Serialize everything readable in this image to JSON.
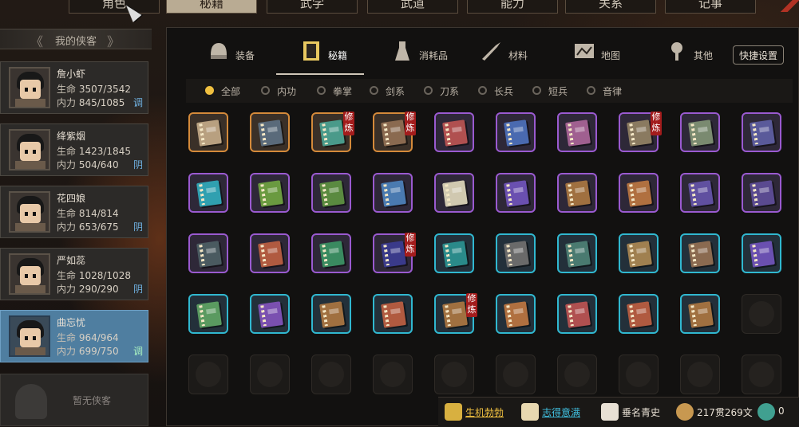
{
  "top_tabs": [
    {
      "label": "角色",
      "active": false
    },
    {
      "label": "秘籍",
      "active": true
    },
    {
      "label": "武学",
      "active": false
    },
    {
      "label": "武道",
      "active": false
    },
    {
      "label": "能力",
      "active": false
    },
    {
      "label": "关系",
      "active": false
    },
    {
      "label": "记事",
      "active": false
    }
  ],
  "sidebar": {
    "header": "我的侠客",
    "characters": [
      {
        "name": "詹小虾",
        "hp_label": "生命",
        "hp": "3507/3542",
        "mp_label": "内力",
        "mp": "845/1085",
        "tag": "调",
        "active": false
      },
      {
        "name": "绛紫烟",
        "hp_label": "生命",
        "hp": "1423/1845",
        "mp_label": "内力",
        "mp": "504/640",
        "tag": "阴",
        "active": false
      },
      {
        "name": "花四娘",
        "hp_label": "生命",
        "hp": "814/814",
        "mp_label": "内力",
        "mp": "653/675",
        "tag": "阴",
        "active": false
      },
      {
        "name": "严如蕊",
        "hp_label": "生命",
        "hp": "1028/1028",
        "mp_label": "内力",
        "mp": "290/290",
        "tag": "阴",
        "active": false
      },
      {
        "name": "曲忘忧",
        "hp_label": "生命",
        "hp": "964/964",
        "mp_label": "内力",
        "mp": "699/750",
        "tag": "调",
        "active": true
      }
    ],
    "empty_slot": "暂无侠客"
  },
  "categories": [
    {
      "label": "装备",
      "icon": "helmet-icon",
      "active": false
    },
    {
      "label": "秘籍",
      "icon": "scroll-icon",
      "active": true
    },
    {
      "label": "消耗品",
      "icon": "potion-icon",
      "active": false
    },
    {
      "label": "材料",
      "icon": "herb-icon",
      "active": false
    },
    {
      "label": "地图",
      "icon": "map-icon",
      "active": false
    },
    {
      "label": "其他",
      "icon": "misc-icon",
      "active": false
    }
  ],
  "quick_settings": "快捷设置",
  "filters": [
    {
      "label": "全部",
      "active": true
    },
    {
      "label": "内功",
      "active": false
    },
    {
      "label": "拳掌",
      "active": false
    },
    {
      "label": "剑系",
      "active": false
    },
    {
      "label": "刀系",
      "active": false
    },
    {
      "label": "长兵",
      "active": false
    },
    {
      "label": "短兵",
      "active": false
    },
    {
      "label": "音律",
      "active": false
    }
  ],
  "practice_tag": "修炼",
  "items": [
    {
      "rarity": "orange",
      "color": "#b8a080",
      "tag": false
    },
    {
      "rarity": "orange",
      "color": "#5a6a7a",
      "tag": false
    },
    {
      "rarity": "orange",
      "color": "#4a9a8a",
      "tag": true
    },
    {
      "rarity": "orange",
      "color": "#8a6a50",
      "tag": true
    },
    {
      "rarity": "purple",
      "color": "#b05050",
      "tag": false
    },
    {
      "rarity": "purple",
      "color": "#4a6ab0",
      "tag": false
    },
    {
      "rarity": "purple",
      "color": "#a06090",
      "tag": false
    },
    {
      "rarity": "purple",
      "color": "#8a7a60",
      "tag": true
    },
    {
      "rarity": "purple",
      "color": "#7a8a70",
      "tag": false
    },
    {
      "rarity": "purple",
      "color": "#5a5a9a",
      "tag": false
    },
    {
      "rarity": "purple",
      "color": "#30a0b0",
      "tag": false
    },
    {
      "rarity": "purple",
      "color": "#6a9a40",
      "tag": false
    },
    {
      "rarity": "purple",
      "color": "#5a8a40",
      "tag": false
    },
    {
      "rarity": "purple",
      "color": "#4a7ab0",
      "tag": false
    },
    {
      "rarity": "purple",
      "color": "#d0c8b0",
      "tag": false
    },
    {
      "rarity": "purple",
      "color": "#6a50b0",
      "tag": false
    },
    {
      "rarity": "purple",
      "color": "#a07040",
      "tag": false
    },
    {
      "rarity": "purple",
      "color": "#b07040",
      "tag": false
    },
    {
      "rarity": "purple",
      "color": "#6050a0",
      "tag": false
    },
    {
      "rarity": "purple",
      "color": "#5a4a90",
      "tag": false
    },
    {
      "rarity": "purple",
      "color": "#4a5a60",
      "tag": false
    },
    {
      "rarity": "purple",
      "color": "#b05a40",
      "tag": false
    },
    {
      "rarity": "purple",
      "color": "#3a8a60",
      "tag": false
    },
    {
      "rarity": "purple",
      "color": "#3a3a8a",
      "tag": true
    },
    {
      "rarity": "cyan",
      "color": "#2a8a8a",
      "tag": false
    },
    {
      "rarity": "cyan",
      "color": "#6a6a6a",
      "tag": false
    },
    {
      "rarity": "cyan",
      "color": "#4a7a70",
      "tag": false
    },
    {
      "rarity": "cyan",
      "color": "#a08050",
      "tag": false
    },
    {
      "rarity": "cyan",
      "color": "#8a6a50",
      "tag": false
    },
    {
      "rarity": "cyan",
      "color": "#6a50b0",
      "tag": false
    },
    {
      "rarity": "cyan",
      "color": "#5a9a60",
      "tag": false
    },
    {
      "rarity": "cyan",
      "color": "#7a50b0",
      "tag": false
    },
    {
      "rarity": "cyan",
      "color": "#a07040",
      "tag": false
    },
    {
      "rarity": "cyan",
      "color": "#b05a40",
      "tag": false
    },
    {
      "rarity": "cyan",
      "color": "#a07040",
      "tag": true
    },
    {
      "rarity": "cyan",
      "color": "#b07040",
      "tag": false
    },
    {
      "rarity": "cyan",
      "color": "#b05050",
      "tag": false
    },
    {
      "rarity": "cyan",
      "color": "#b05a40",
      "tag": false
    },
    {
      "rarity": "cyan",
      "color": "#a07040",
      "tag": false
    }
  ],
  "total_slots": 50,
  "bottom_bar": [
    {
      "label": "生机勃勃",
      "icon": "vitality-icon",
      "color": "#f0c040"
    },
    {
      "label": "志得意满",
      "icon": "mood-icon",
      "color": "#40c0e0"
    },
    {
      "label": "垂名青史",
      "icon": "fame-icon",
      "color": "#e8e0d4"
    },
    {
      "label": "217贯269文",
      "icon": "coin-icon",
      "color": "#e8e0d4"
    },
    {
      "label": "0",
      "icon": "jade-icon",
      "color": "#e8e0d4"
    }
  ]
}
